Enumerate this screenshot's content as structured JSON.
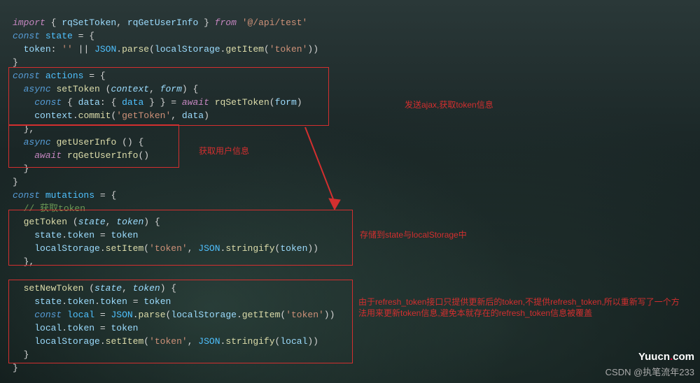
{
  "code": {
    "l1a": "import",
    "l1b": " { ",
    "l1c": "rqSetToken",
    "l1d": ", ",
    "l1e": "rqGetUserInfo",
    "l1f": " } ",
    "l1g": "from",
    "l1h": " ",
    "l1i": "'@/api/test'",
    "l2a": "const",
    "l2b": " ",
    "l2c": "state",
    "l2d": " = {",
    "l3a": "  ",
    "l3b": "token",
    "l3c": ": ",
    "l3d": "''",
    "l3e": " || ",
    "l3f": "JSON",
    "l3g": ".",
    "l3h": "parse",
    "l3i": "(",
    "l3j": "localStorage",
    "l3k": ".",
    "l3l": "getItem",
    "l3m": "(",
    "l3n": "'token'",
    "l3o": "))",
    "l4a": "}",
    "l5a": "const",
    "l5b": " ",
    "l5c": "actions",
    "l5d": " = {",
    "l6a": "  ",
    "l6b": "async",
    "l6c": " ",
    "l6d": "setToken",
    "l6e": " (",
    "l6f": "context",
    "l6g": ", ",
    "l6h": "form",
    "l6i": ") {",
    "l7a": "    ",
    "l7b": "const",
    "l7c": " { ",
    "l7d": "data",
    "l7e": ": { ",
    "l7f": "data",
    "l7g": " } } = ",
    "l7h": "await",
    "l7i": " ",
    "l7j": "rqSetToken",
    "l7k": "(",
    "l7l": "form",
    "l7m": ")",
    "l8a": "    ",
    "l8b": "context",
    "l8c": ".",
    "l8d": "commit",
    "l8e": "(",
    "l8f": "'getToken'",
    "l8g": ", ",
    "l8h": "data",
    "l8i": ")",
    "l9a": "  },",
    "l10a": "  ",
    "l10b": "async",
    "l10c": " ",
    "l10d": "getUserInfo",
    "l10e": " () {",
    "l11a": "    ",
    "l11b": "await",
    "l11c": " ",
    "l11d": "rqGetUserInfo",
    "l11e": "()",
    "l12a": "  }",
    "l13a": "}",
    "l14a": "const",
    "l14b": " ",
    "l14c": "mutations",
    "l14d": " = {",
    "l15a": "  ",
    "l15b": "// 获取token",
    "l16a": "  ",
    "l16b": "getToken",
    "l16c": " (",
    "l16d": "state",
    "l16e": ", ",
    "l16f": "token",
    "l16g": ") {",
    "l17a": "    ",
    "l17b": "state",
    "l17c": ".",
    "l17d": "token",
    "l17e": " = ",
    "l17f": "token",
    "l18a": "    ",
    "l18b": "localStorage",
    "l18c": ".",
    "l18d": "setItem",
    "l18e": "(",
    "l18f": "'token'",
    "l18g": ", ",
    "l18h": "JSON",
    "l18i": ".",
    "l18j": "stringify",
    "l18k": "(",
    "l18l": "token",
    "l18m": "))",
    "l19a": "  },",
    "l20a": "  ",
    "l20b": "setNewToken",
    "l20c": " (",
    "l20d": "state",
    "l20e": ", ",
    "l20f": "token",
    "l20g": ") {",
    "l21a": "    ",
    "l21b": "state",
    "l21c": ".",
    "l21d": "token",
    "l21e": ".",
    "l21f": "token",
    "l21g": " = ",
    "l21h": "token",
    "l22a": "    ",
    "l22b": "const",
    "l22c": " ",
    "l22d": "local",
    "l22e": " = ",
    "l22f": "JSON",
    "l22g": ".",
    "l22h": "parse",
    "l22i": "(",
    "l22j": "localStorage",
    "l22k": ".",
    "l22l": "getItem",
    "l22m": "(",
    "l22n": "'token'",
    "l22o": "))",
    "l23a": "    ",
    "l23b": "local",
    "l23c": ".",
    "l23d": "token",
    "l23e": " = ",
    "l23f": "token",
    "l24a": "    ",
    "l24b": "localStorage",
    "l24c": ".",
    "l24d": "setItem",
    "l24e": "(",
    "l24f": "'token'",
    "l24g": ", ",
    "l24h": "JSON",
    "l24i": ".",
    "l24j": "stringify",
    "l24k": "(",
    "l24l": "local",
    "l24m": "))",
    "l25a": "  }",
    "l26a": "}"
  },
  "annotations": {
    "a1": "发送ajax,获取token信息",
    "a2": "获取用户信息",
    "a3": "存储到state与localStorage中",
    "a4": "由于refresh_token接口只提供更新后的token,不提供refresh_token,所以重新写了一个方法用来更新token信息,避免本就存在的refresh_token信息被覆盖"
  },
  "watermark": {
    "brand": "Yuucn",
    "dot": ".",
    "tld": "com",
    "csdn": "CSDN @执笔流年233"
  }
}
